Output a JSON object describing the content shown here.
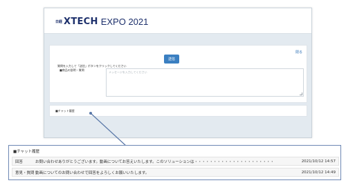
{
  "header": {
    "brand_small": "日経",
    "brand_logo": "XTECH",
    "brand_rest": "EXPO 2021"
  },
  "form": {
    "close_label": "閉る",
    "send_label": "送信",
    "instruction": "質問を入力して「送信」ボタンをクリックしてください",
    "field_label": "■商品の説明・質問",
    "message_placeholder": "メッセージを入力してください"
  },
  "history_small": {
    "title": "■チャット履歴"
  },
  "callout": {
    "title": "■チャット履歴",
    "rows": [
      {
        "type": "回答",
        "text": "お問い合わせありがとうございます。動画についてお答えいたします。このソリューションは・・・・・・・・・・・・・・・・・・・・・",
        "date": "2021/10/12 14:57"
      },
      {
        "type": "意見・質問",
        "text": "動画についてのお問い合わせで回答をよろしくお願いいたします。",
        "date": "2021/10/12 14:49"
      }
    ]
  },
  "colors": {
    "brand": "#1c2f6b",
    "accent": "#3a7fc1",
    "connector": "#5a78a8"
  }
}
